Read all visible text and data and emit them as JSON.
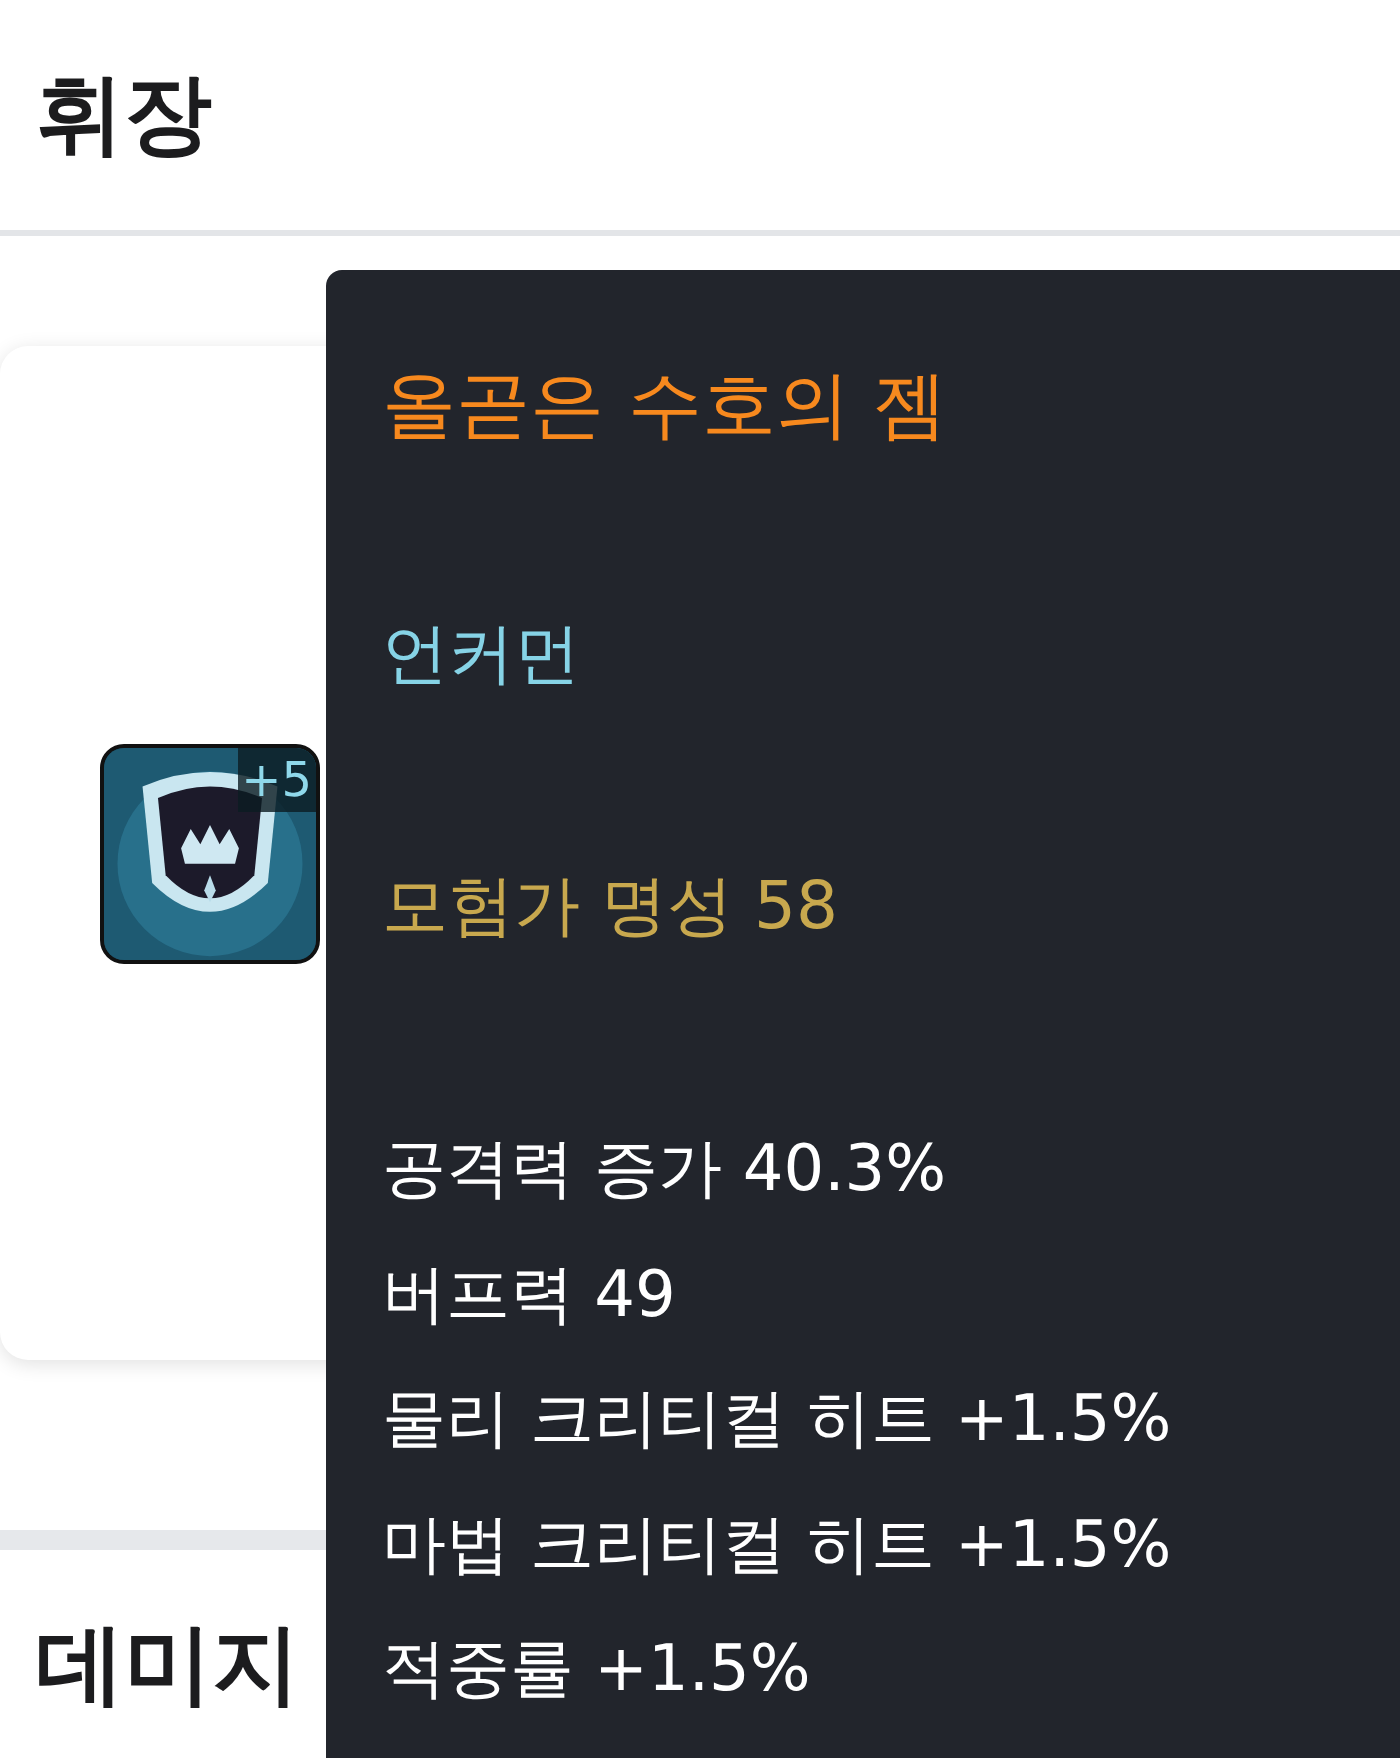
{
  "section_title": "휘장",
  "item": {
    "enhance": "+5"
  },
  "next_section_title": "데미지",
  "tooltip": {
    "name": "올곧은 수호의 젬",
    "rarity": "언커먼",
    "fame": "모험가 명성 58",
    "stats": [
      "공격력 증가 40.3%",
      "버프력 49",
      "물리 크리티컬 히트 +1.5%",
      "마법 크리티컬 히트 +1.5%",
      "적중률 +1.5%"
    ]
  }
}
